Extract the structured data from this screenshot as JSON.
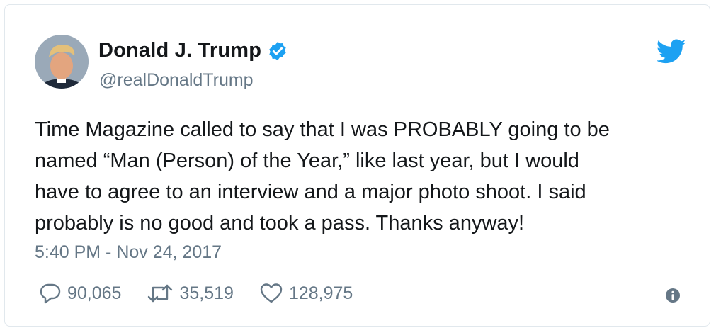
{
  "author": {
    "name": "Donald J. Trump",
    "handle": "@realDonaldTrump",
    "verified": true
  },
  "tweet": {
    "text": "Time Magazine called to say that I was PROBABLY going to be\nnamed “Man (Person) of the Year,” like last year, but I would\nhave to agree to an interview and a major photo shoot. I said\nprobably is no good and took a pass. Thanks anyway!",
    "timestamp": "5:40 PM - Nov 24, 2017"
  },
  "actions": {
    "replies": "90,065",
    "retweets": "35,519",
    "likes": "128,975"
  },
  "icons": {
    "brand": "twitter-bird-icon",
    "reply": "reply-icon",
    "retweet": "retweet-icon",
    "like": "heart-icon",
    "info": "info-icon",
    "verified": "verified-badge-icon"
  },
  "colors": {
    "twitter_blue": "#1da1f2",
    "secondary_text": "#657786",
    "primary_text": "#14171a",
    "border": "#e1e8ed"
  }
}
